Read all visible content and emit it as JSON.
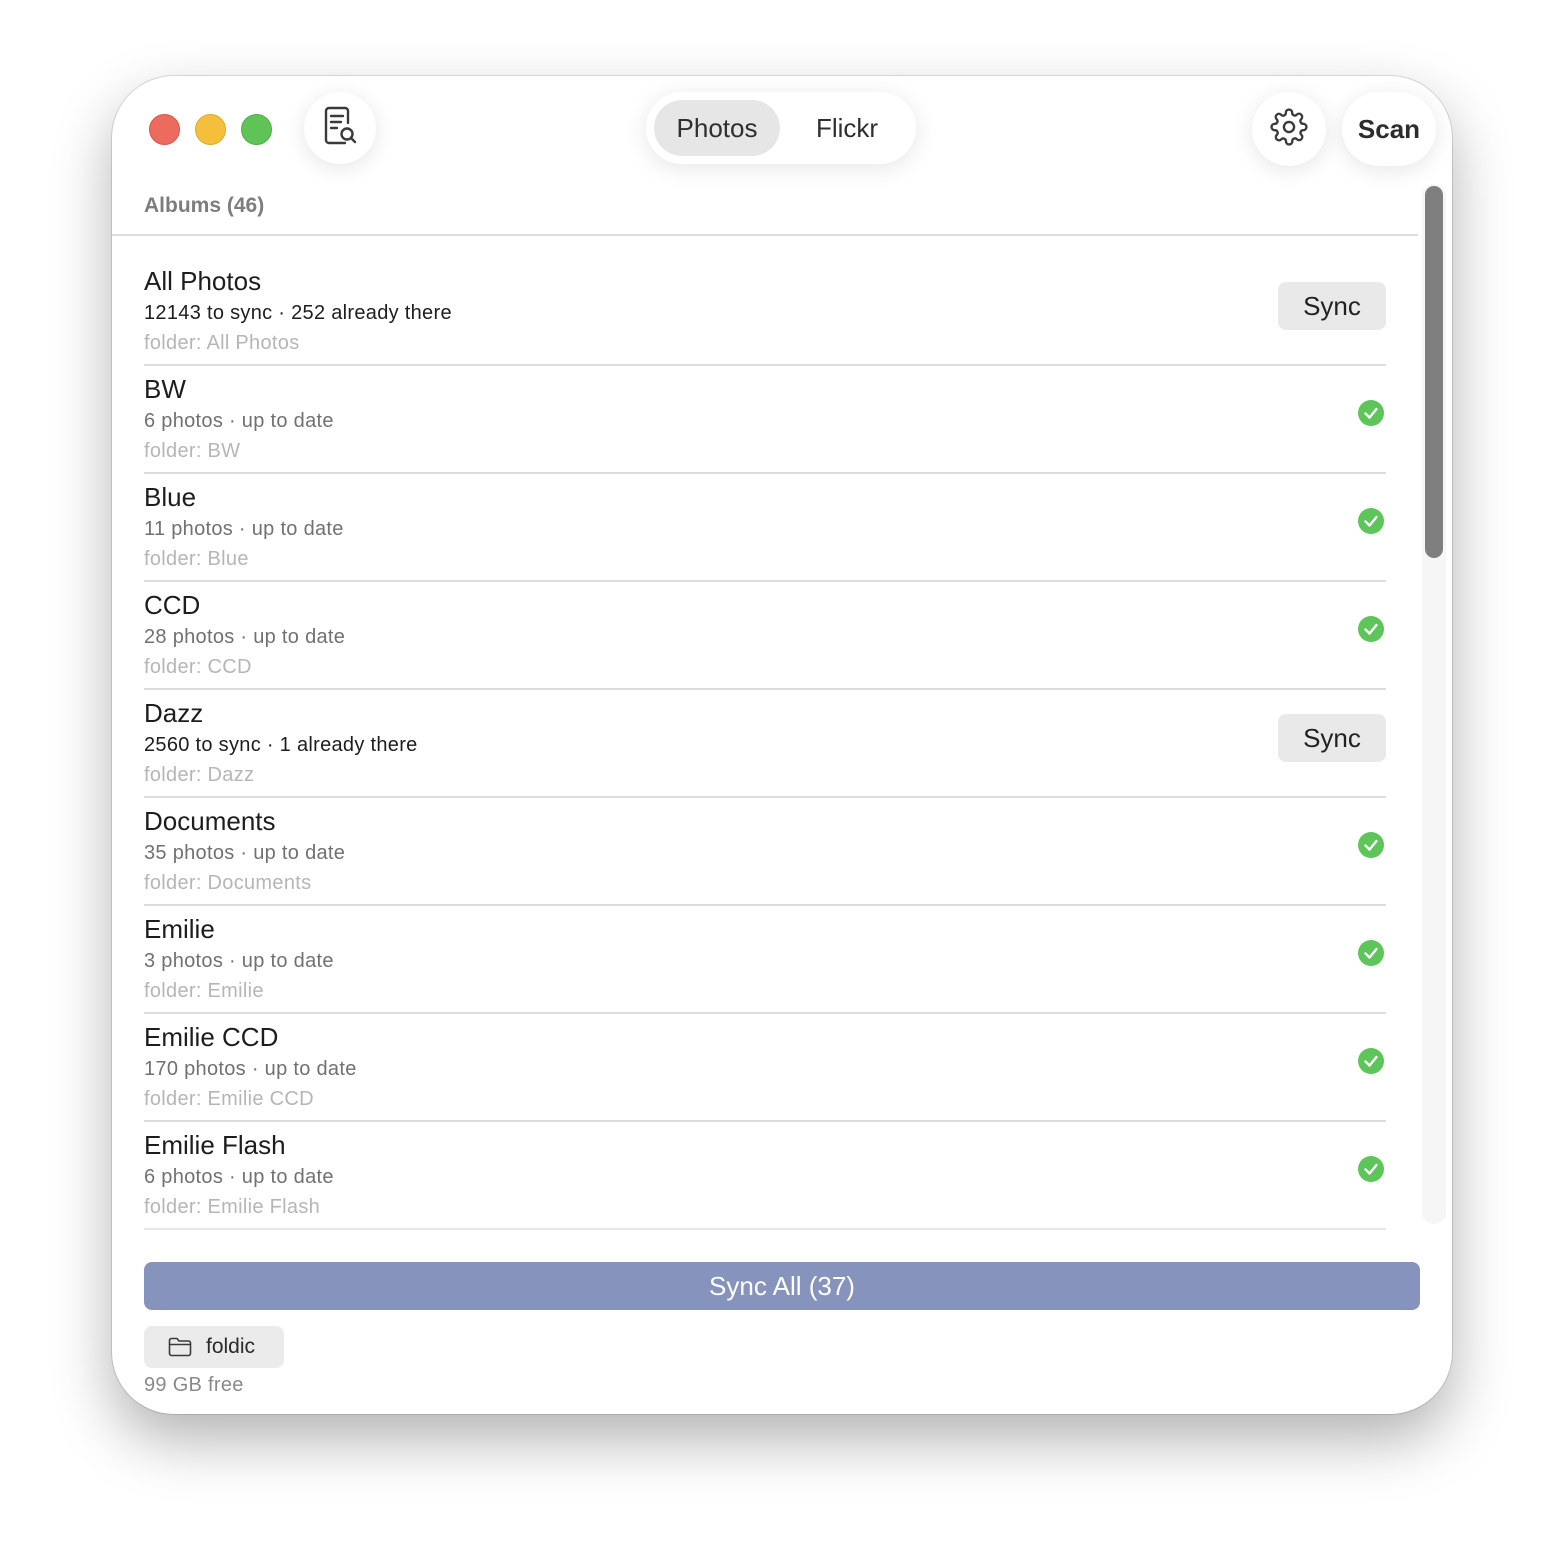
{
  "window": {
    "segments": [
      {
        "label": "Photos",
        "selected": true
      },
      {
        "label": "Flickr",
        "selected": false
      }
    ],
    "scan_label": "Scan"
  },
  "colors": {
    "accent_button": "#8693bd",
    "check_green": "#5ec55b",
    "traffic_red": "#ec6b5e",
    "traffic_yellow": "#f4c03b",
    "traffic_green": "#5fc455"
  },
  "icons": {
    "log": "document-search-icon",
    "settings": "gear-icon",
    "folder": "folder-icon",
    "up_to_date": "checkmark-circle-icon"
  },
  "albums_header": "Albums (46)",
  "albums": [
    {
      "name": "All Photos",
      "status": "12143 to sync · 252 already there",
      "folder": "folder: All Photos",
      "action": "Sync"
    },
    {
      "name": "BW",
      "status": "6 photos · up to date",
      "folder": "folder: BW"
    },
    {
      "name": "Blue",
      "status": "11 photos · up to date",
      "folder": "folder: Blue"
    },
    {
      "name": "CCD",
      "status": "28 photos · up to date",
      "folder": "folder: CCD"
    },
    {
      "name": "Dazz",
      "status": "2560 to sync · 1 already there",
      "folder": "folder: Dazz",
      "action": "Sync"
    },
    {
      "name": "Documents",
      "status": "35 photos · up to date",
      "folder": "folder: Documents"
    },
    {
      "name": "Emilie",
      "status": "3 photos · up to date",
      "folder": "folder: Emilie"
    },
    {
      "name": "Emilie CCD",
      "status": "170 photos · up to date",
      "folder": "folder: Emilie CCD"
    },
    {
      "name": "Emilie Flash",
      "status": "6 photos · up to date",
      "folder": "folder: Emilie Flash"
    }
  ],
  "footer": {
    "sync_all_label": "Sync All (37)",
    "destination_folder": "foldic",
    "free_space": "99 GB free"
  }
}
